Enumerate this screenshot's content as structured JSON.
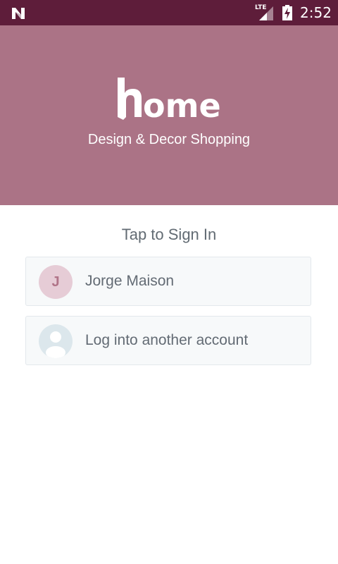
{
  "status_bar": {
    "network_type": "LTE",
    "time": "2:52",
    "icons": [
      "n-notification-icon",
      "signal-icon",
      "battery-charging-icon"
    ],
    "background": "#5e1d3a"
  },
  "hero": {
    "logo_text": "home",
    "tagline": "Design & Decor Shopping",
    "background": "#ab7386"
  },
  "signin": {
    "title": "Tap to Sign In",
    "accounts": [
      {
        "initial": "J",
        "name": "Jorge Maison",
        "avatar_color": "#e6ccd6"
      },
      {
        "name": "Log into another account",
        "avatar_icon": "person-icon"
      }
    ]
  }
}
